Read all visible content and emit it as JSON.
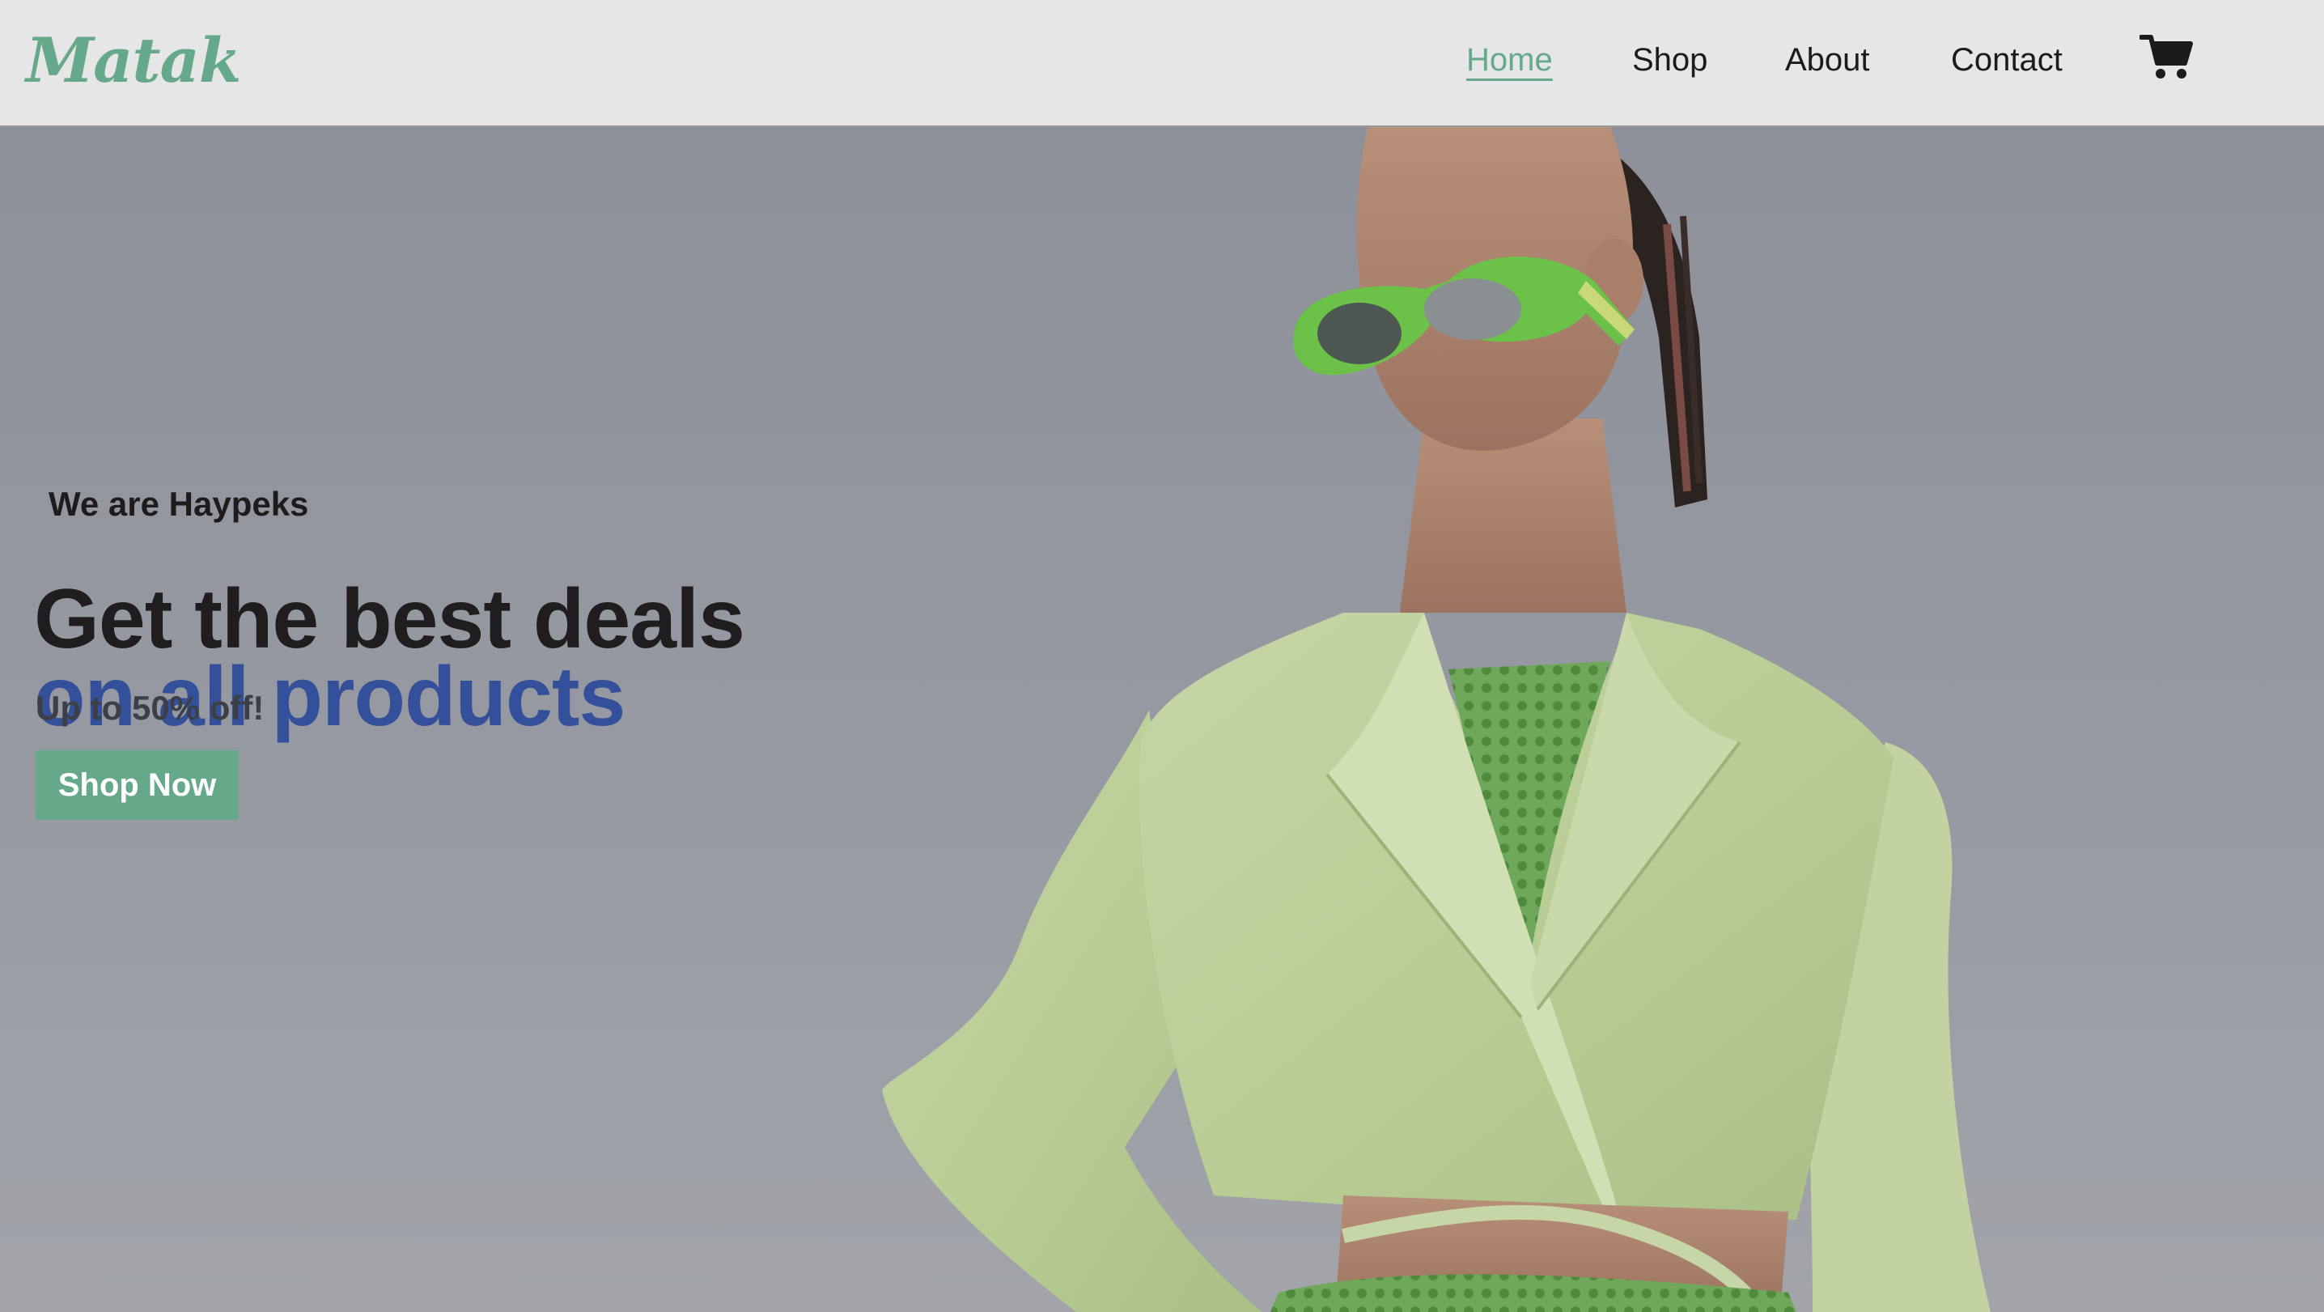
{
  "brand": {
    "logo_text": "Matak",
    "accent_color": "#66a98a",
    "secondary_color": "#34509a"
  },
  "nav": {
    "items": [
      {
        "label": "Home",
        "active": true
      },
      {
        "label": "Shop",
        "active": false
      },
      {
        "label": "About",
        "active": false
      },
      {
        "label": "Contact",
        "active": false
      }
    ],
    "cart_icon": "shopping-cart-icon"
  },
  "hero": {
    "eyebrow": "We are Haypeks",
    "headline_line1": "Get the best deals",
    "headline_line2": "on all products",
    "subline": "Up to 50% off!",
    "cta_label": "Shop Now",
    "image_subject": "model-in-green-blazer-and-sunglasses"
  }
}
